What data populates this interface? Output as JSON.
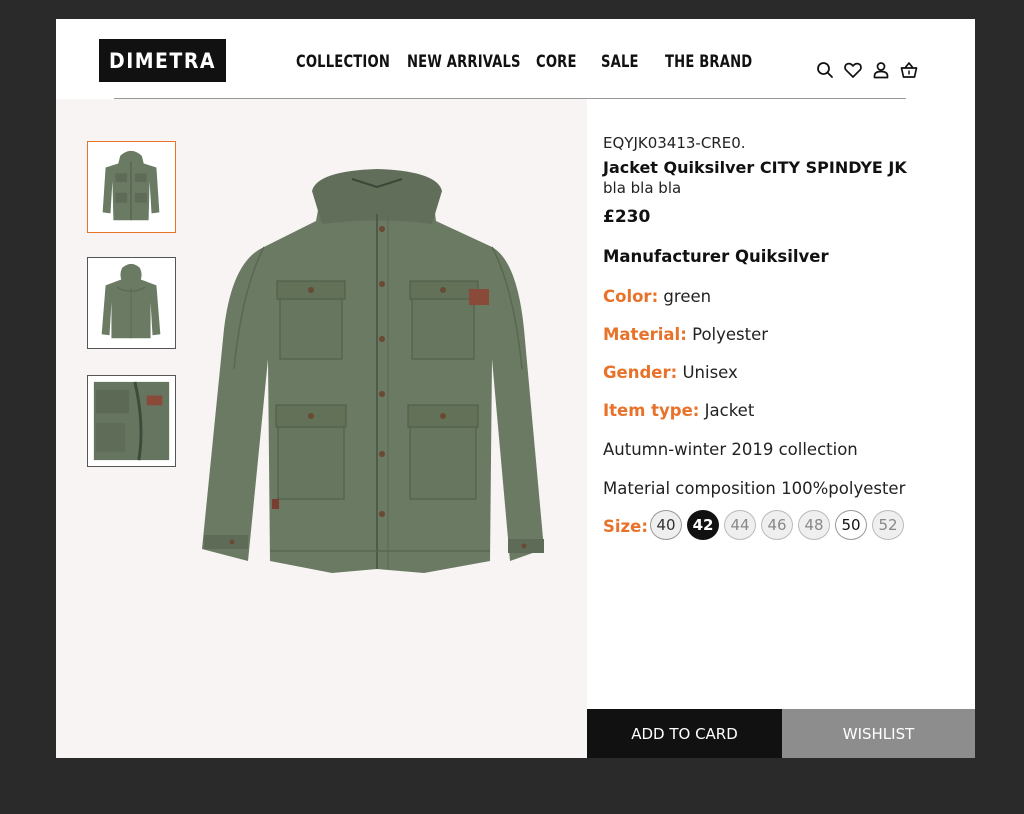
{
  "brand": {
    "logo_text": "DIMETRA"
  },
  "nav": {
    "items": [
      {
        "label": "COLLECTION"
      },
      {
        "label": "NEW ARRIVALS"
      },
      {
        "label": "CORE"
      },
      {
        "label": "SALE"
      },
      {
        "label": "THE BRAND"
      }
    ]
  },
  "header_icons": [
    "search-icon",
    "heart-icon",
    "user-icon",
    "basket-icon"
  ],
  "gallery": {
    "thumbnails": [
      {
        "view": "front",
        "active": true
      },
      {
        "view": "back",
        "active": false
      },
      {
        "view": "detail",
        "active": false
      }
    ]
  },
  "product": {
    "sku": "EQYJK03413-CRE0.",
    "title": "Jacket Quiksilver CITY SPINDYE JK",
    "subtitle": "bla bla bla",
    "price": "£230",
    "manufacturer": "Manufacturer Quiksilver",
    "attributes": [
      {
        "key": "Color:",
        "value": "green"
      },
      {
        "key": "Material:",
        "value": "Polyester"
      },
      {
        "key": "Gender:",
        "value": "Unisex"
      },
      {
        "key": "Item type:",
        "value": "Jacket"
      }
    ],
    "collection": "Autumn-winter 2019 collection",
    "composition": "Material composition 100%polyester",
    "size_label": "Size:",
    "sizes": [
      {
        "label": "40",
        "state": "available"
      },
      {
        "label": "42",
        "state": "selected"
      },
      {
        "label": "44",
        "state": "unavailable"
      },
      {
        "label": "46",
        "state": "unavailable"
      },
      {
        "label": "48",
        "state": "unavailable"
      },
      {
        "label": "50",
        "state": "available"
      },
      {
        "label": "52",
        "state": "unavailable"
      }
    ]
  },
  "actions": {
    "add_label": "ADD TO CARD",
    "wishlist_label": "WISHLIST"
  },
  "colors": {
    "accent": "#e8722a",
    "jacket": "#6b7a63",
    "dark": "#111111",
    "wishlist_bg": "#8d8d8d"
  }
}
